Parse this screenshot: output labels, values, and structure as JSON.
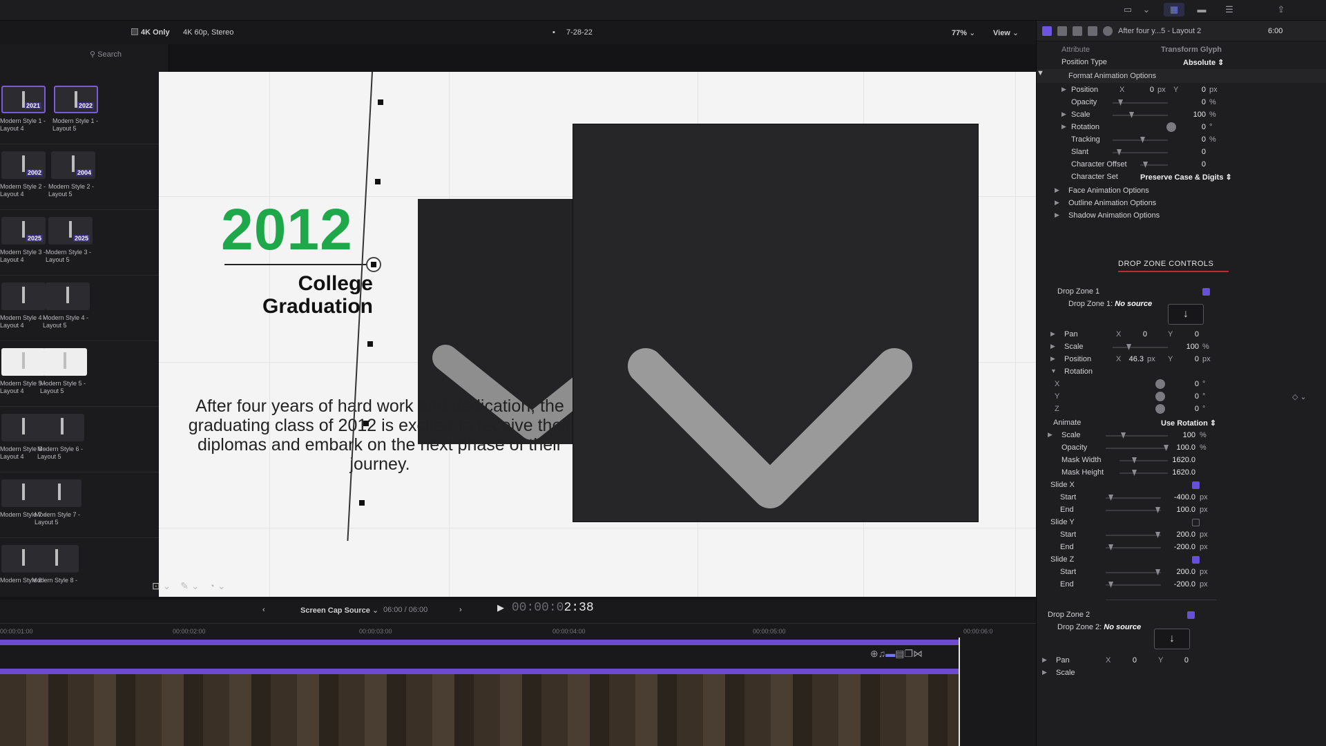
{
  "viewer": {
    "only_4k_label": "4K Only",
    "format": "4K 60p, Stereo",
    "project": "7-28-22",
    "zoom": "77%",
    "view_label": "View"
  },
  "browser": {
    "search_placeholder": "Search",
    "items": [
      {
        "left": "Modern Style 1 - Layout 4",
        "right": "Modern Style 1 - Layout 5"
      },
      {
        "left": "Modern Style 2 - Layout 4",
        "right": "Modern Style 2 - Layout 5"
      },
      {
        "left": "Modern Style 3 - Layout 4",
        "right": "Modern Style 3 - Layout 5"
      },
      {
        "left": "Modern Style 4 - Layout 4",
        "right": "Modern Style 4 - Layout 5"
      },
      {
        "left": "Modern Style 5 - Layout 4",
        "right": "Modern Style 5 - Layout 5"
      },
      {
        "left": "Modern Style 6 - Layout 4",
        "right": "Modern Style 6 - Layout 5"
      },
      {
        "left": "Modern Style 7 -",
        "right": "Modern Style 7 - Layout 5"
      },
      {
        "left": "Modern Style 8 -",
        "right": "Modern Style 8 -"
      }
    ],
    "thumb_years": [
      "2021",
      "2022",
      "2002",
      "2004",
      "2025",
      "2025"
    ]
  },
  "canvas": {
    "year": "2012",
    "subtitle": "College\nGraduation",
    "body": "After four years of hard work and dedication, the graduating class of 2012 is excited to receive their diplomas and embark on the next phase of their journey."
  },
  "timeline": {
    "source": "Screen Cap Source",
    "duration": "06:00 / 06:00",
    "timecode_dim": "00:00:0",
    "timecode_lit": "2:38",
    "ruler": [
      "00:00:01:00",
      "00:00:02:00",
      "00:00:03:00",
      "00:00:04:00",
      "00:00:05:00",
      "00:00:06:0"
    ]
  },
  "inspector": {
    "title": "After four y...5 - Layout 2",
    "time": "6:00",
    "attribute_label": "Attribute",
    "attribute_value": "Transform Glyph",
    "position_type_label": "Position Type",
    "position_type_value": "Absolute",
    "format_section": "Format Animation Options",
    "position": {
      "label": "Position",
      "x": "0",
      "y": "0",
      "unit": "px"
    },
    "opacity": {
      "label": "Opacity",
      "value": "0",
      "unit": "%"
    },
    "scale": {
      "label": "Scale",
      "value": "100",
      "unit": "%"
    },
    "rotation": {
      "label": "Rotation",
      "value": "0",
      "unit": "°"
    },
    "tracking": {
      "label": "Tracking",
      "value": "0",
      "unit": "%"
    },
    "slant": {
      "label": "Slant",
      "value": "0"
    },
    "char_offset": {
      "label": "Character Offset",
      "value": "0"
    },
    "char_set": {
      "label": "Character Set",
      "value": "Preserve Case & Digits"
    },
    "face_section": "Face Animation Options",
    "outline_section": "Outline Animation Options",
    "shadow_section": "Shadow Animation Options",
    "drop_zone_controls": "DROP ZONE CONTROLS",
    "dz1": {
      "label": "Drop Zone 1",
      "source_label": "Drop Zone 1:",
      "source_value": "No source",
      "pan": {
        "label": "Pan",
        "x": "0",
        "y": "0"
      },
      "scale": {
        "label": "Scale",
        "value": "100",
        "unit": "%"
      },
      "position": {
        "label": "Position",
        "x": "46.3",
        "y": "0",
        "unit": "px"
      },
      "rotation": {
        "label": "Rotation",
        "x": "0",
        "y": "0",
        "z": "0",
        "unit": "°"
      }
    },
    "animate_label": "Animate",
    "animate_value": "Use Rotation",
    "anim_scale": {
      "label": "Scale",
      "value": "100",
      "unit": "%"
    },
    "anim_opacity": {
      "label": "Opacity",
      "value": "100.0",
      "unit": "%"
    },
    "mask_width": {
      "label": "Mask Width",
      "value": "1620.0"
    },
    "mask_height": {
      "label": "Mask Height",
      "value": "1620.0"
    },
    "slide_x": {
      "label": "Slide X",
      "start": "-400.0",
      "end": "100.0",
      "unit": "px"
    },
    "slide_y": {
      "label": "Slide Y",
      "start": "200.0",
      "end": "-200.0",
      "unit": "px"
    },
    "slide_z": {
      "label": "Slide Z",
      "start": "200.0",
      "end": "-200.0",
      "unit": "px"
    },
    "start_label": "Start",
    "end_label": "End",
    "dz2": {
      "label": "Drop Zone 2",
      "source_label": "Drop Zone 2:",
      "source_value": "No source",
      "pan": {
        "label": "Pan",
        "x": "0",
        "y": "0"
      },
      "scale": {
        "label": "Scale"
      }
    },
    "axis_x": "X",
    "axis_y": "Y",
    "axis_z": "Z"
  }
}
